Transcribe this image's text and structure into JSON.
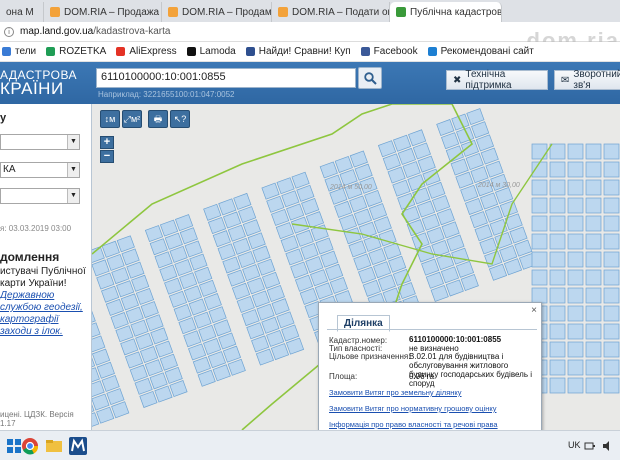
{
  "browser": {
    "tabs": [
      {
        "label": "она М",
        "active": false
      },
      {
        "label": "DOM.RIA – Продажа нед",
        "active": false
      },
      {
        "label": "DOM.RIA – Продам учас",
        "active": false
      },
      {
        "label": "DOM.RIA – Подати огол",
        "active": false
      },
      {
        "label": "Публічна кадастрова ка",
        "active": true
      }
    ],
    "close_glyph": "×",
    "url_host": "map.land.gov.ua",
    "url_path": "/kadastrova-karta",
    "bookmarks": [
      "тели",
      "ROZETKA",
      "AliExpress",
      "Lamoda",
      "Найди! Сравни! Куп",
      "Facebook",
      "Рекомендовані сайт"
    ],
    "watermark": "dom.ria"
  },
  "header": {
    "logo_line1": "АДАСТРОВА",
    "logo_line2": "КРАЇНИ",
    "search_value": "6110100000:10:001:0855",
    "search_example": "Наприклад: 3221655100:01:047:0052",
    "support_label": "Технічна підтримка",
    "feedback_label": "Зворотний зв'я",
    "colors": {
      "header": "#3c78b5",
      "parcel_fill": "#bcd7ef",
      "parcel_stroke": "#6ea3d2",
      "boundary": "#8ec63f"
    }
  },
  "left_panel": {
    "title": "у",
    "select1": "",
    "select2": "КА",
    "select3": "",
    "date": "я: 03.03.2019 03:00",
    "notice_title": "домлення",
    "notice_text": "истувачі Публічної карти України!",
    "notice_link": "Державною службою геодезії, картографії заходи з ілок.",
    "footer": "ицені. ЦДЗК. Версія 1.17"
  },
  "map": {
    "tools": [
      {
        "icon": "measure-line-icon",
        "glyph": "↕м"
      },
      {
        "icon": "measure-area-icon",
        "glyph": "⤢м²"
      },
      {
        "icon": "print-icon",
        "glyph": "🖶"
      },
      {
        "icon": "info-cursor-icon",
        "glyph": "↖?"
      }
    ],
    "zoom_in": "+",
    "zoom_out": "−",
    "labels": [
      "2014 м 50,00",
      "2014 м 30,00"
    ]
  },
  "popup": {
    "tab": "Ділянка",
    "close": "×",
    "rows": [
      {
        "label": "Кадастр.номер:",
        "value": "6110100000:10:001:0855"
      },
      {
        "label": "Тип власності:",
        "value": "не визначено"
      },
      {
        "label": "Цільове призначення:",
        "value": "В.02.01 для будівництва і обслуговування житлового будинку господарських будівель і споруд"
      },
      {
        "label": "Площа:",
        "value": "0.06 га"
      }
    ],
    "links": [
      "Замовити Витяг про земельну ділянку",
      "Замовити Витяг про нормативну грошову оцінку",
      "Інформація про право власності та речові права"
    ]
  },
  "taskbar": {
    "lang": "UK"
  }
}
